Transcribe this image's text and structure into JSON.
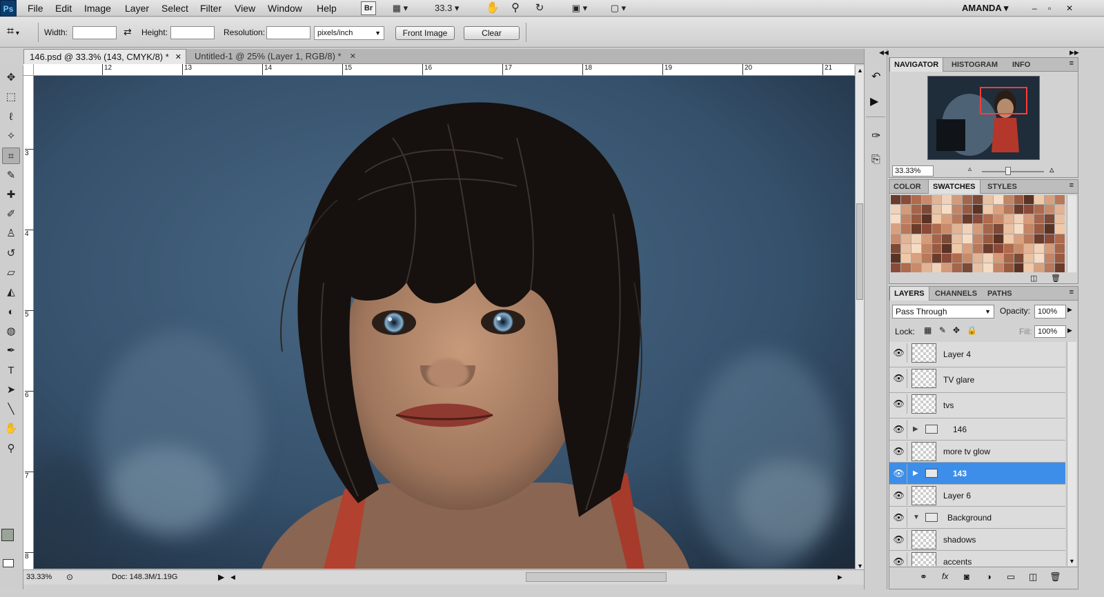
{
  "app": {
    "logo": "Ps",
    "user": "AMANDA",
    "zoom_field": "33.3"
  },
  "menu": [
    "File",
    "Edit",
    "Image",
    "Layer",
    "Select",
    "Filter",
    "View",
    "Window",
    "Help"
  ],
  "appbar": {
    "bridge_label": "Br",
    "window_controls": [
      "–",
      "▫",
      "✕"
    ]
  },
  "options": {
    "width_label": "Width:",
    "width_value": "",
    "height_label": "Height:",
    "height_value": "",
    "resolution_label": "Resolution:",
    "resolution_value": "",
    "unit_select": "pixels/inch",
    "front_image_button": "Front Image",
    "clear_button": "Clear"
  },
  "tabs": [
    {
      "label": "146.psd @ 33.3% (143, CMYK/8) *",
      "close": "✕"
    },
    {
      "label": "Untitled-1 @ 25% (Layer 1, RGB/8) *",
      "close": "✕"
    }
  ],
  "ruler": {
    "h": [
      "12",
      "13",
      "14",
      "15",
      "16",
      "17",
      "18",
      "19",
      "20",
      "21"
    ],
    "v": [
      "3",
      "4",
      "5",
      "6",
      "7",
      "8"
    ]
  },
  "status": {
    "zoom": "33.33%",
    "doc": "Doc: 148.3M/1.19G"
  },
  "navigator": {
    "tabs": [
      "NAVIGATOR",
      "HISTOGRAM",
      "INFO"
    ],
    "zoom": "33.33%"
  },
  "color_panel": {
    "tabs": [
      "COLOR",
      "SWATCHES",
      "STYLES"
    ]
  },
  "layers_panel": {
    "tabs": [
      "LAYERS",
      "CHANNELS",
      "PATHS"
    ],
    "blend_mode": "Pass Through",
    "opacity_label": "Opacity:",
    "opacity": "100%",
    "lock_label": "Lock:",
    "fill_label": "Fill:",
    "fill": "100%",
    "layers": [
      {
        "name": "Layer 4",
        "type": "layer"
      },
      {
        "name": "TV glare",
        "type": "layer"
      },
      {
        "name": "tvs",
        "type": "layer"
      },
      {
        "name": "146",
        "type": "group"
      },
      {
        "name": "more tv glow",
        "type": "layer"
      },
      {
        "name": "143",
        "type": "group",
        "selected": true
      },
      {
        "name": "Layer 6",
        "type": "layer"
      },
      {
        "name": "Background",
        "type": "group-open"
      },
      {
        "name": "shadows",
        "type": "layer"
      },
      {
        "name": "accents",
        "type": "layer"
      }
    ]
  },
  "tools": [
    {
      "name": "move-tool",
      "glyph": "✥"
    },
    {
      "name": "marquee-tool",
      "glyph": "⬚"
    },
    {
      "name": "lasso-tool",
      "glyph": "ℓ"
    },
    {
      "name": "magic-wand-tool",
      "glyph": "✧"
    },
    {
      "name": "crop-tool",
      "glyph": "⌗"
    },
    {
      "name": "eyedropper-tool",
      "glyph": "✎"
    },
    {
      "name": "healing-tool",
      "glyph": "✚"
    },
    {
      "name": "brush-tool",
      "glyph": "✐"
    },
    {
      "name": "clone-stamp-tool",
      "glyph": "♙"
    },
    {
      "name": "history-brush-tool",
      "glyph": "↺"
    },
    {
      "name": "eraser-tool",
      "glyph": "▱"
    },
    {
      "name": "paint-bucket-tool",
      "glyph": "◭"
    },
    {
      "name": "dodge-tool",
      "glyph": "◐"
    },
    {
      "name": "sponge-tool",
      "glyph": "◍"
    },
    {
      "name": "pen-tool",
      "glyph": "✒"
    },
    {
      "name": "type-tool",
      "glyph": "T"
    },
    {
      "name": "path-select-tool",
      "glyph": "➤"
    },
    {
      "name": "line-tool",
      "glyph": "╲"
    },
    {
      "name": "hand-tool",
      "glyph": "✋"
    },
    {
      "name": "zoom-tool",
      "glyph": "⚲"
    }
  ],
  "colors": {
    "accent": "#3d8ee8",
    "canvas_bg": "#36506a"
  }
}
